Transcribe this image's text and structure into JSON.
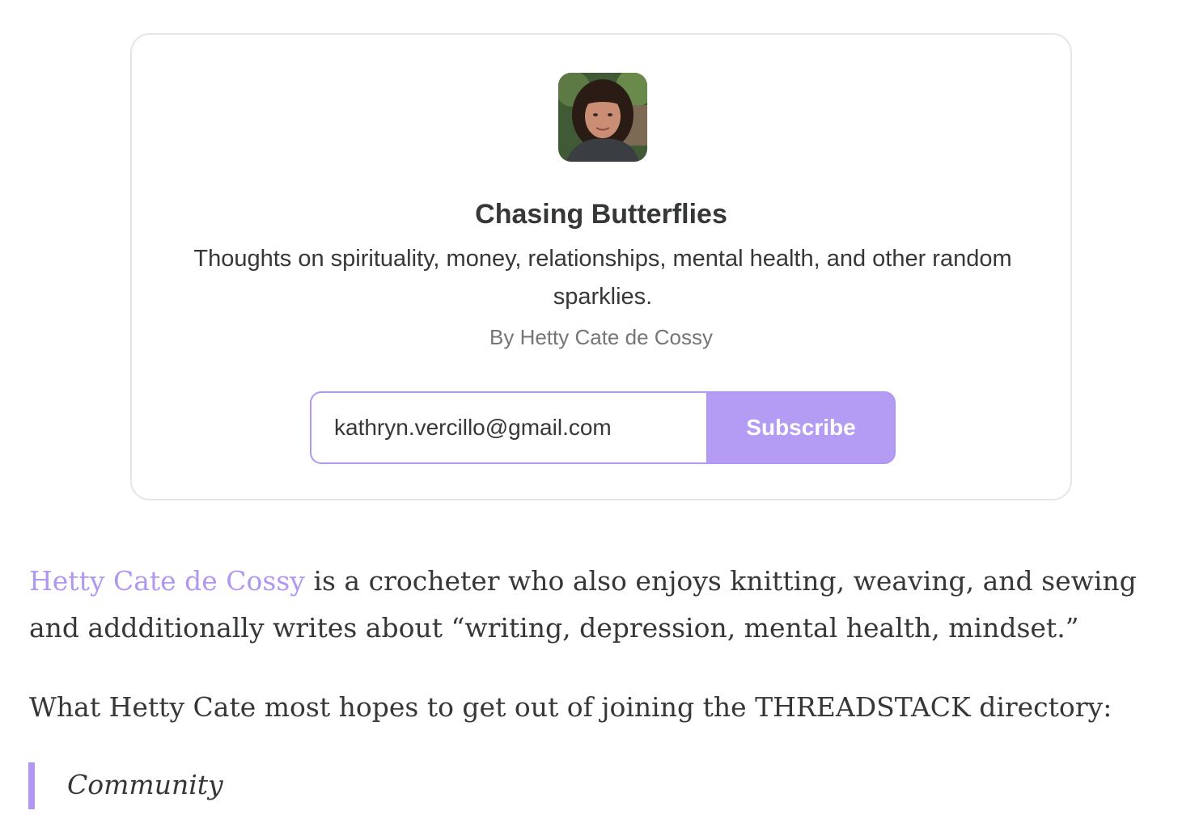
{
  "embed": {
    "avatar_icon": "author-photo",
    "title": "Chasing Butterflies",
    "description": "Thoughts on spirituality, money, relationships, mental health, and other random sparklies.",
    "author": "By Hetty Cate de Cossy",
    "email_value": "kathryn.vercillo@gmail.com",
    "subscribe_label": "Subscribe",
    "accent_color": "#b197f2"
  },
  "article": {
    "para1_link": "Hetty Cate de Cossy",
    "para1_rest": " is a crocheter who also enjoys knitting, weaving, and sewing and addditionally writes about “writing, depression, mental health, mindset.”",
    "para2": "What Hetty Cate most hopes to get out of joining the THREADSTACK directory:",
    "quote": "Community"
  }
}
